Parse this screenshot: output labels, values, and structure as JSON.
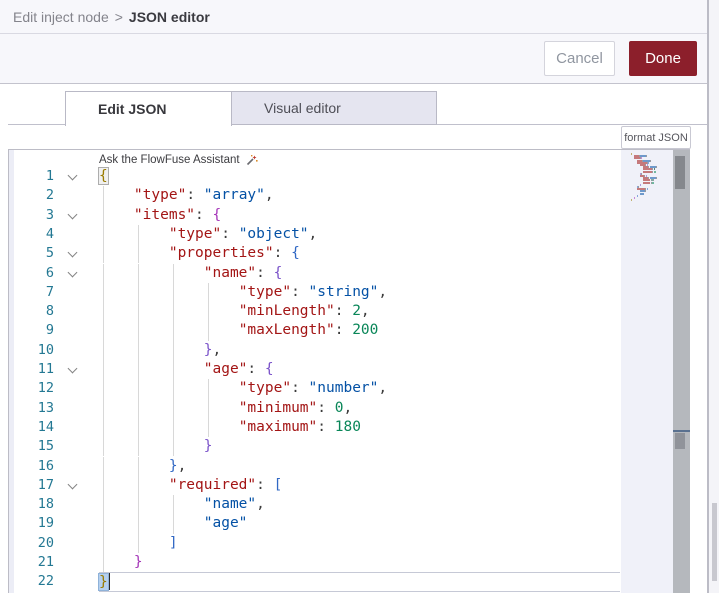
{
  "header": {
    "breadcrumb_parent": "Edit inject node",
    "breadcrumb_separator": ">",
    "breadcrumb_current": "JSON editor"
  },
  "actions": {
    "cancel_label": "Cancel",
    "done_label": "Done",
    "done_color": "#8c1f2b"
  },
  "tabs": [
    {
      "label": "Edit JSON",
      "active": true
    },
    {
      "label": "Visual editor",
      "active": false
    }
  ],
  "toolbar": {
    "format_button_label": "format JSON"
  },
  "editor": {
    "assistant_placeholder": "Ask the FlowFuse Assistant",
    "language": "json",
    "line_count": 22,
    "token_colors": {
      "key": "#a31515",
      "string": "#0451a5",
      "number": "#098658",
      "punctuation": "#3b3b3b"
    },
    "lines": [
      {
        "num": 1,
        "indent": 0,
        "fold": true,
        "guides": 0,
        "segments": [
          [
            "{",
            "b1 bm"
          ]
        ]
      },
      {
        "num": 2,
        "indent": 4,
        "fold": false,
        "guides": 1,
        "segments": [
          [
            "\"type\"",
            "key"
          ],
          [
            ":",
            "punc"
          ],
          [
            " ",
            ""
          ],
          [
            "\"array\"",
            "str"
          ],
          [
            ",",
            "punc"
          ]
        ]
      },
      {
        "num": 3,
        "indent": 4,
        "fold": true,
        "guides": 1,
        "segments": [
          [
            "\"items\"",
            "key"
          ],
          [
            ":",
            "punc"
          ],
          [
            " ",
            ""
          ],
          [
            "{",
            "b2"
          ]
        ]
      },
      {
        "num": 4,
        "indent": 8,
        "fold": false,
        "guides": 2,
        "segments": [
          [
            "\"type\"",
            "key"
          ],
          [
            ":",
            "punc"
          ],
          [
            " ",
            ""
          ],
          [
            "\"object\"",
            "str"
          ],
          [
            ",",
            "punc"
          ]
        ]
      },
      {
        "num": 5,
        "indent": 8,
        "fold": true,
        "guides": 2,
        "segments": [
          [
            "\"properties\"",
            "key"
          ],
          [
            ":",
            "punc"
          ],
          [
            " ",
            ""
          ],
          [
            "{",
            "b3"
          ]
        ]
      },
      {
        "num": 6,
        "indent": 12,
        "fold": true,
        "guides": 3,
        "segments": [
          [
            "\"name\"",
            "key"
          ],
          [
            ":",
            "punc"
          ],
          [
            " ",
            ""
          ],
          [
            "{",
            "b4"
          ]
        ]
      },
      {
        "num": 7,
        "indent": 16,
        "fold": false,
        "guides": 4,
        "segments": [
          [
            "\"type\"",
            "key"
          ],
          [
            ":",
            "punc"
          ],
          [
            " ",
            ""
          ],
          [
            "\"string\"",
            "str"
          ],
          [
            ",",
            "punc"
          ]
        ]
      },
      {
        "num": 8,
        "indent": 16,
        "fold": false,
        "guides": 4,
        "segments": [
          [
            "\"minLength\"",
            "key"
          ],
          [
            ":",
            "punc"
          ],
          [
            " ",
            ""
          ],
          [
            "2",
            "num"
          ],
          [
            ",",
            "punc"
          ]
        ]
      },
      {
        "num": 9,
        "indent": 16,
        "fold": false,
        "guides": 4,
        "segments": [
          [
            "\"maxLength\"",
            "key"
          ],
          [
            ":",
            "punc"
          ],
          [
            " ",
            ""
          ],
          [
            "200",
            "num"
          ]
        ]
      },
      {
        "num": 10,
        "indent": 12,
        "fold": false,
        "guides": 3,
        "segments": [
          [
            "}",
            "b4"
          ],
          [
            ",",
            "punc"
          ]
        ]
      },
      {
        "num": 11,
        "indent": 12,
        "fold": true,
        "guides": 3,
        "segments": [
          [
            "\"age\"",
            "key"
          ],
          [
            ":",
            "punc"
          ],
          [
            " ",
            ""
          ],
          [
            "{",
            "b4"
          ]
        ]
      },
      {
        "num": 12,
        "indent": 16,
        "fold": false,
        "guides": 4,
        "segments": [
          [
            "\"type\"",
            "key"
          ],
          [
            ":",
            "punc"
          ],
          [
            " ",
            ""
          ],
          [
            "\"number\"",
            "str"
          ],
          [
            ",",
            "punc"
          ]
        ]
      },
      {
        "num": 13,
        "indent": 16,
        "fold": false,
        "guides": 4,
        "segments": [
          [
            "\"minimum\"",
            "key"
          ],
          [
            ":",
            "punc"
          ],
          [
            " ",
            ""
          ],
          [
            "0",
            "num"
          ],
          [
            ",",
            "punc"
          ]
        ]
      },
      {
        "num": 14,
        "indent": 16,
        "fold": false,
        "guides": 4,
        "segments": [
          [
            "\"maximum\"",
            "key"
          ],
          [
            ":",
            "punc"
          ],
          [
            " ",
            ""
          ],
          [
            "180",
            "num"
          ]
        ]
      },
      {
        "num": 15,
        "indent": 12,
        "fold": false,
        "guides": 3,
        "segments": [
          [
            "}",
            "b4"
          ]
        ]
      },
      {
        "num": 16,
        "indent": 8,
        "fold": false,
        "guides": 2,
        "segments": [
          [
            "}",
            "b3"
          ],
          [
            ",",
            "punc"
          ]
        ]
      },
      {
        "num": 17,
        "indent": 8,
        "fold": true,
        "guides": 2,
        "segments": [
          [
            "\"required\"",
            "key"
          ],
          [
            ":",
            "punc"
          ],
          [
            " ",
            ""
          ],
          [
            "[",
            "b3"
          ]
        ]
      },
      {
        "num": 18,
        "indent": 12,
        "fold": false,
        "guides": 3,
        "segments": [
          [
            "\"name\"",
            "str"
          ],
          [
            ",",
            "punc"
          ]
        ]
      },
      {
        "num": 19,
        "indent": 12,
        "fold": false,
        "guides": 3,
        "segments": [
          [
            "\"age\"",
            "str"
          ]
        ]
      },
      {
        "num": 20,
        "indent": 8,
        "fold": false,
        "guides": 2,
        "segments": [
          [
            "]",
            "b3"
          ]
        ]
      },
      {
        "num": 21,
        "indent": 4,
        "fold": false,
        "guides": 1,
        "segments": [
          [
            "}",
            "b2"
          ]
        ]
      },
      {
        "num": 22,
        "indent": 0,
        "fold": false,
        "guides": 0,
        "current": true,
        "cursor": true,
        "segments": [
          [
            "}",
            "b1 sel"
          ]
        ]
      }
    ]
  }
}
